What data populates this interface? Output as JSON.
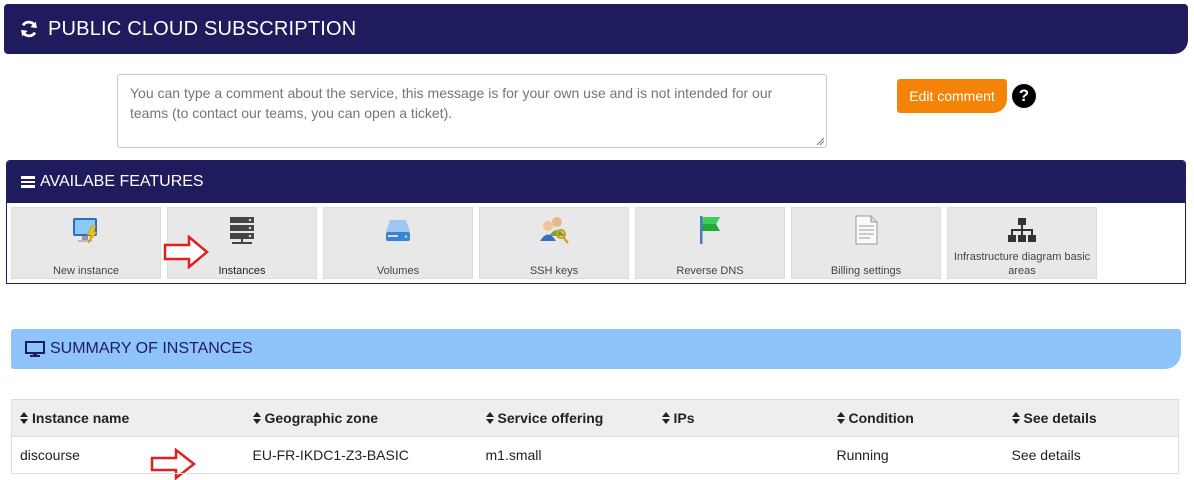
{
  "header": {
    "title": "PUBLIC CLOUD SUBSCRIPTION",
    "icon": "refresh-icon"
  },
  "comment": {
    "placeholder": "You can type a comment about the service, this message is for your own use and is not intended for our teams (to contact our teams, you can open a ticket).",
    "edit_button_label": "Edit comment",
    "help_glyph": "?"
  },
  "features": {
    "title": "AVAILABE FEATURES",
    "items": [
      {
        "label": "New instance",
        "icon": "monitor-lightning-icon"
      },
      {
        "label": "Instances",
        "icon": "server-stack-icon"
      },
      {
        "label": "Volumes",
        "icon": "disk-drive-icon"
      },
      {
        "label": "SSH keys",
        "icon": "users-key-icon"
      },
      {
        "label": "Reverse DNS",
        "icon": "green-flag-icon"
      },
      {
        "label": "Billing settings",
        "icon": "document-icon"
      },
      {
        "label": "Infrastructure diagram basic areas",
        "icon": "sitemap-icon"
      }
    ]
  },
  "summary": {
    "title": "SUMMARY OF INSTANCES",
    "columns": [
      "Instance name",
      "Geographic zone",
      "Service offering",
      "IPs",
      "Condition",
      "See details"
    ],
    "rows": [
      {
        "instance_name": "discourse",
        "zone": "EU-FR-IKDC1-Z3-BASIC",
        "offering": "m1.small",
        "ips": "",
        "condition": "Running",
        "details": "See details"
      }
    ]
  },
  "colors": {
    "navy": "#1f1c5e",
    "orange": "#f58307",
    "light_blue": "#8fc3fb",
    "arrow_red": "#e02020"
  }
}
